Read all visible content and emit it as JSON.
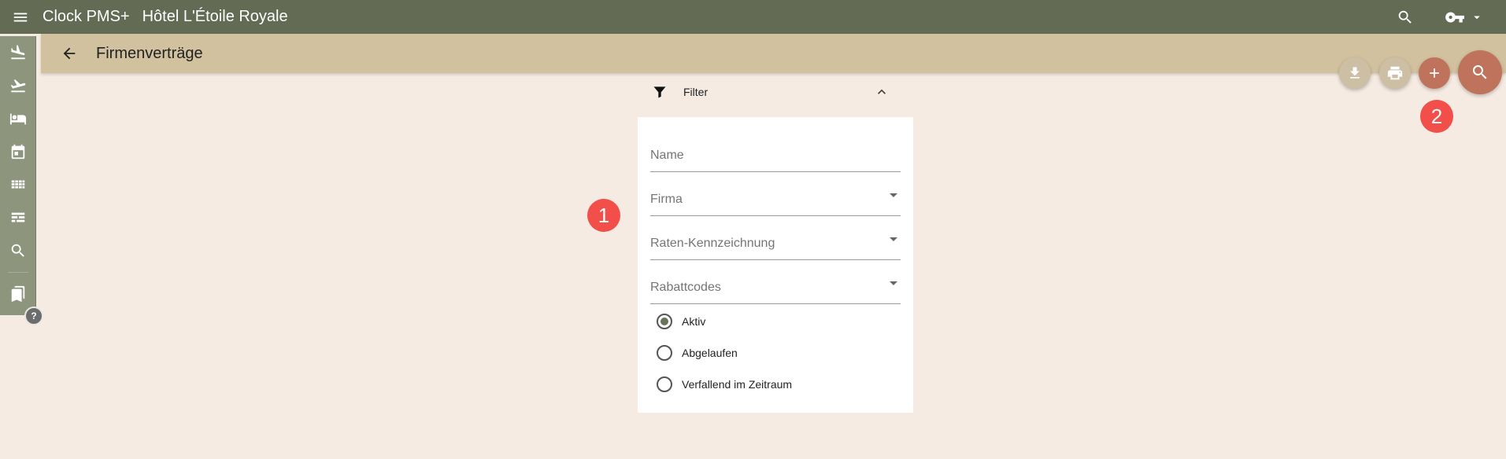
{
  "topbar": {
    "app_title": "Clock PMS+",
    "hotel_name": "Hôtel L'Étoile Royale",
    "icons": [
      "menu-icon",
      "search-icon",
      "key-icon",
      "caret-down-icon"
    ],
    "bg_color": "#636b54"
  },
  "subheader": {
    "title": "Firmenverträge",
    "bg_color": "#d2c19e"
  },
  "sidenav": {
    "items": [
      "flight-land-icon",
      "flight-takeoff-icon",
      "bed-icon",
      "calendar-icon",
      "grid-icon",
      "table-icon",
      "search-icon",
      "bookmark-icon"
    ],
    "help_label": "?"
  },
  "fabs": {
    "icons": [
      "download-icon",
      "print-icon",
      "add-icon",
      "search-icon"
    ],
    "accent_color": "#c0735c"
  },
  "markers": {
    "m1": "1",
    "m2": "2"
  },
  "filter": {
    "title": "Filter",
    "fields": {
      "name": "Name",
      "firma": "Firma",
      "raten": "Raten-Kennzeichnung",
      "rabatt": "Rabattcodes"
    },
    "radios": {
      "aktiv": "Aktiv",
      "abgelaufen": "Abgelaufen",
      "verfallend": "Verfallend im Zeitraum"
    },
    "selected": "Aktiv"
  }
}
